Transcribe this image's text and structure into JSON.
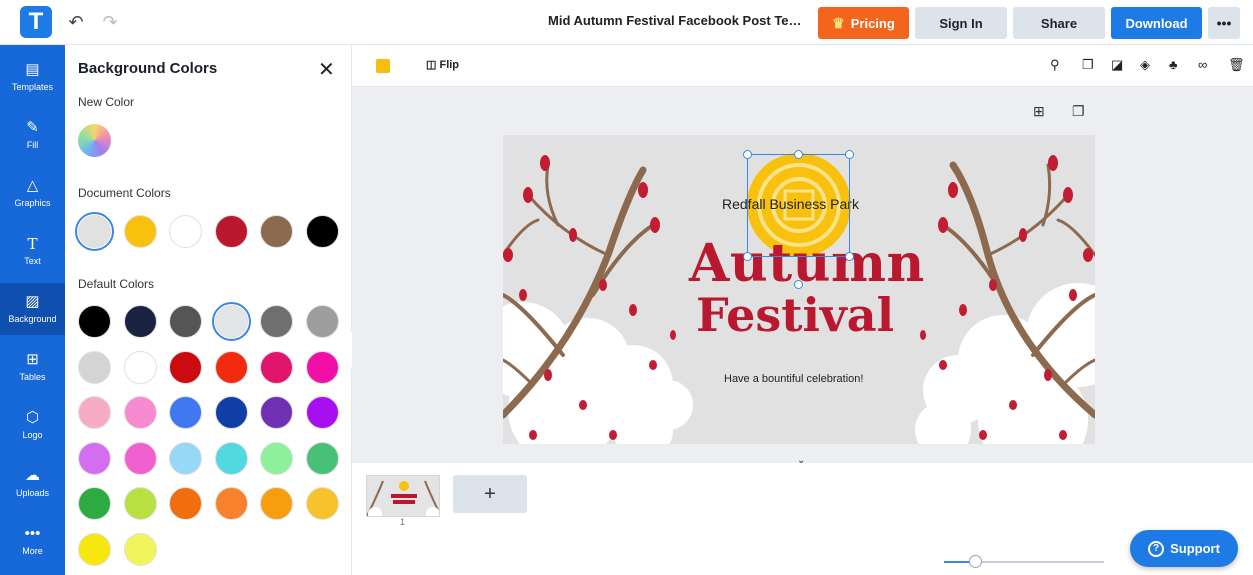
{
  "header": {
    "logo_letter": "T",
    "undo_icon": "↶",
    "redo_icon": "↷",
    "doc_title": "Mid Autumn Festival Facebook Post Temp...",
    "pricing_label": "Pricing",
    "signin_label": "Sign In",
    "share_label": "Share",
    "download_label": "Download",
    "more_label": "•••",
    "accent": "#1e7be6",
    "pricing_color": "#f3641c"
  },
  "rail": {
    "items": [
      {
        "label": "Templates",
        "icon": "templates-icon"
      },
      {
        "label": "Fill",
        "icon": "fill-icon"
      },
      {
        "label": "Graphics",
        "icon": "graphics-icon"
      },
      {
        "label": "Text",
        "icon": "text-icon"
      },
      {
        "label": "Background",
        "icon": "background-icon"
      },
      {
        "label": "Tables",
        "icon": "tables-icon"
      },
      {
        "label": "Logo",
        "icon": "logo-icon"
      },
      {
        "label": "Uploads",
        "icon": "uploads-icon"
      },
      {
        "label": "More",
        "icon": "more-icon"
      }
    ],
    "active": "Background"
  },
  "panel": {
    "title": "Background Colors",
    "new_color_label": "New Color",
    "document_colors_label": "Document Colors",
    "default_colors_label": "Default Colors",
    "document_colors": [
      "#e1e1e1",
      "#f8c10e",
      "#ffffff",
      "#b9182e",
      "#8b6a4d",
      "#000000"
    ],
    "default_colors": [
      "#000000",
      "#1a2442",
      "#555555",
      "#e3e5e8",
      "#6f6f6f",
      "#9e9e9e",
      "#d4d4d4",
      "#ffffff",
      "#cc0b10",
      "#f22b0f",
      "#e0156b",
      "#f20fa8",
      "#f7abc4",
      "#f78bd2",
      "#3f77f0",
      "#0f3fa4",
      "#6f30b3",
      "#a80ff0",
      "#d36ef0",
      "#f061cf",
      "#98d8f7",
      "#52d8e0",
      "#8ef09a",
      "#48c078",
      "#2bab40",
      "#b8e041",
      "#f26d0e",
      "#f7822b",
      "#f79e0e",
      "#f7c22b",
      "#f7e70e",
      "#eff55a"
    ]
  },
  "toolbar": {
    "flip_label": "Flip"
  },
  "design": {
    "subtitle": "Redfall Business Park",
    "title_line1": "Autumn",
    "title_line2": "Festival",
    "tagline": "Have a bountiful celebration!",
    "title_color": "#b9182e"
  },
  "pages": {
    "thumb_number": "1",
    "add_label": "+"
  },
  "support_label": "Support"
}
